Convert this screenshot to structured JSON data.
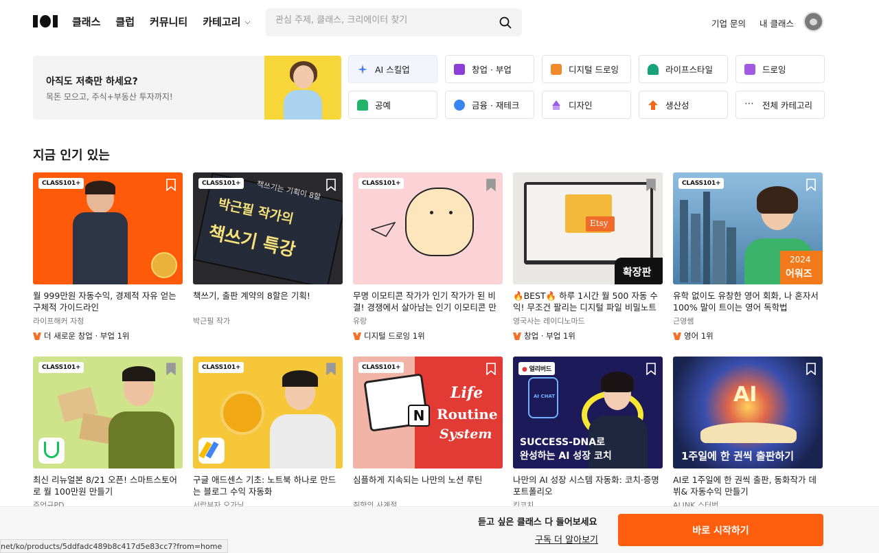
{
  "header": {
    "nav": [
      "클래스",
      "클럽",
      "커뮤니티",
      "카테고리"
    ],
    "search_placeholder": "관심 주제, 클래스, 크리에이터 찾기",
    "links": [
      "기업 문의",
      "내 클래스"
    ]
  },
  "promo": {
    "title": "아직도 저축만 하세요?",
    "subtitle": "목돈 모으고, 주식+부동산 투자까지!"
  },
  "categories": [
    {
      "label": "AI 스킬업",
      "color": "#4a7cf0"
    },
    {
      "label": "창업 · 부업",
      "color": "#8b3fd6"
    },
    {
      "label": "디지털 드로잉",
      "color": "#f08a2c"
    },
    {
      "label": "라이프스타일",
      "color": "#17a37a"
    },
    {
      "label": "드로잉",
      "color": "#a15be0"
    },
    {
      "label": "공예",
      "color": "#21b46a"
    },
    {
      "label": "금융 · 재테크",
      "color": "#3a86f0"
    },
    {
      "label": "디자인",
      "color": "#9b5de5"
    },
    {
      "label": "생산성",
      "color": "#f06a1e"
    },
    {
      "label": "전체 카테고리",
      "color": "#333333"
    }
  ],
  "section_title": "지금 인기 있는",
  "cards": [
    {
      "badge": "CLASS101+",
      "title": "월 999만원 자동수익, 경제적 자유 얻는 구체적 가이드라인",
      "author": "라이프해커 자청",
      "rank": "더 새로운 창업 · 부업 1위",
      "bg": "#ff5a0a"
    },
    {
      "badge": "CLASS101+",
      "title": "책쓰기, 출판 계약의 8할은 기획!",
      "author": "박근필 작가",
      "rank": "",
      "bg": "#2a2a2e",
      "art1": "책쓰기는 기획이 8할",
      "art2": "박근필 작가의",
      "art3": "책쓰기 특강"
    },
    {
      "badge": "CLASS101+",
      "title": "무명 이모티콘 작가가 인기 작가가 된 비결! 경쟁에서 살아남는 인기 이모티콘 만들기",
      "author": "유랑",
      "rank": "디지털 드로잉 1위",
      "bg": "#fbd3d6"
    },
    {
      "badge": "",
      "title": "🔥BEST🔥 하루 1시간 월 500 자동 수익! 무조건 팔리는 디지털 파일 비밀노트",
      "author": "영국사는 레이디노마드",
      "rank": "창업 · 부업 1위",
      "bg": "#e9e7e3",
      "art1": "Etsy",
      "art2": "확장판"
    },
    {
      "badge": "CLASS101+",
      "title": "유학 없이도 유창한 영어 회화, 나 혼자서 100% 말이 트이는 영어 독학법",
      "author": "근영쌤",
      "rank": "영어 1위",
      "bg": "#6fa2c9",
      "art1": "2024",
      "art2": "어워즈"
    },
    {
      "badge": "CLASS101+",
      "title": "최신 리뉴얼본 8/21 오픈! 스마트스토어로 월 100만원 만들기",
      "author": "주언규PD",
      "rank": "",
      "bg": "#cfe38a"
    },
    {
      "badge": "CLASS101+",
      "title": "구글 애드센스 기초: 노트북 하나로 만드는 블로그 수익 자동화",
      "author": "서랍부자 오가닉",
      "rank": "",
      "bg": "#f7c73a"
    },
    {
      "badge": "CLASS101+",
      "title": "심플하게 지속되는 나만의 노션 루틴",
      "author": "취향의 사계절",
      "rank": "",
      "bg": "#e23b35",
      "art1": "Life",
      "art2": "Routine",
      "art3": "System"
    },
    {
      "badge": "얼리버드",
      "title": "나만의 AI 성장 시스템 자동화: 코치·증명 포트폴리오",
      "author": "킨코치",
      "rank": "",
      "bg": "#1d1a5a",
      "art1": "SUCCESS-DNA로",
      "art2": "완성하는 AI 성장 코치",
      "art3": "AI CHAT"
    },
    {
      "badge": "",
      "title": "AI로 1주일에 한 권씩 출판, 동화작가 데뷔& 자동수익 만들기",
      "author": "ALINK 스터번",
      "rank": "",
      "bg": "#1d2c5e",
      "art1": "AI",
      "art2": "1주일에 한 권씩 출판하기"
    }
  ],
  "bottom": {
    "text": "듣고 싶은 클래스 다 들어보세요",
    "link": "구독 더 알아보기",
    "cta": "바로 시작하기"
  },
  "status_url": "net/ko/products/5ddfadc489b8c417d5e83cc7?from=home"
}
